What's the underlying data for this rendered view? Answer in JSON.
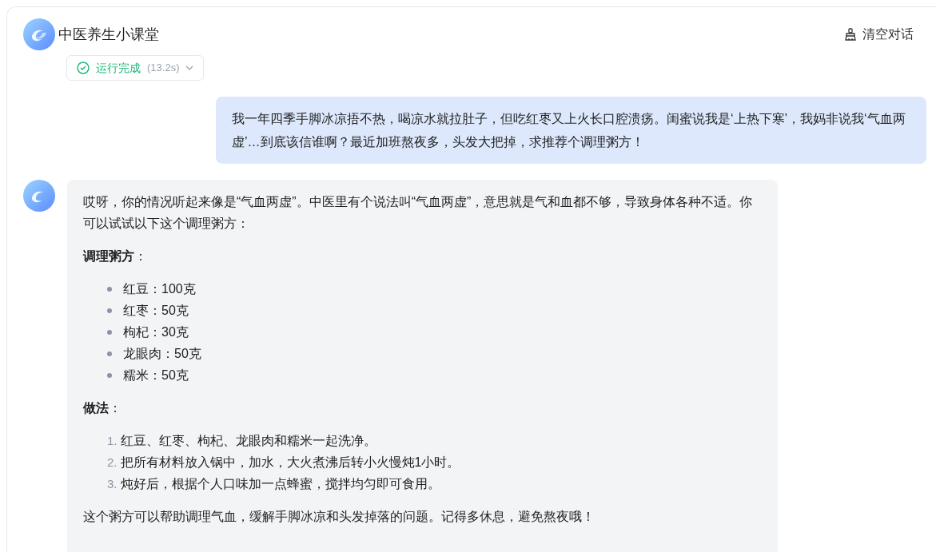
{
  "header": {
    "title": "中医养生小课堂",
    "clear_button": "清空对话"
  },
  "run_status": {
    "label": "运行完成",
    "duration": "(13.2s)"
  },
  "messages": [
    {
      "kind": "user",
      "text": "我一年四季手脚冰凉捂不热，喝凉水就拉肚子，但吃红枣又上火长口腔溃疡。闺蜜说我是‘上热下寒’，我妈非说我‘气血两虚’…到底该信谁啊？最近加班熬夜多，头发大把掉，求推荐个调理粥方！"
    },
    {
      "kind": "assistant",
      "blocks": [
        {
          "kind": "paragraph",
          "text": "哎呀，你的情况听起来像是“气血两虚”。中医里有个说法叫“气血两虚”，意思就是气和血都不够，导致身体各种不适。你可以试试以下这个调理粥方："
        },
        {
          "kind": "paragraph",
          "text": "**调理粥方**："
        },
        {
          "kind": "bullets",
          "items": [
            "红豆：100克",
            "红枣：50克",
            "枸杞：30克",
            "龙眼肉：50克",
            "糯米：50克"
          ]
        },
        {
          "kind": "paragraph",
          "text": "**做法**："
        },
        {
          "kind": "numbered",
          "items": [
            {
              "number": "1.",
              "text": "红豆、红枣、枸杞、龙眼肉和糯米一起洗净。"
            },
            {
              "number": "2.",
              "text": "把所有材料放入锅中，加水，大火煮沸后转小火慢炖1小时。"
            },
            {
              "number": "3.",
              "text": "炖好后，根据个人口味加一点蜂蜜，搅拌均匀即可食用。"
            }
          ]
        },
        {
          "kind": "paragraph",
          "text": "这个粥方可以帮助调理气血，缓解手脚冰凉和头发掉落的问题。记得多休息，避免熬夜哦！"
        }
      ]
    }
  ]
}
